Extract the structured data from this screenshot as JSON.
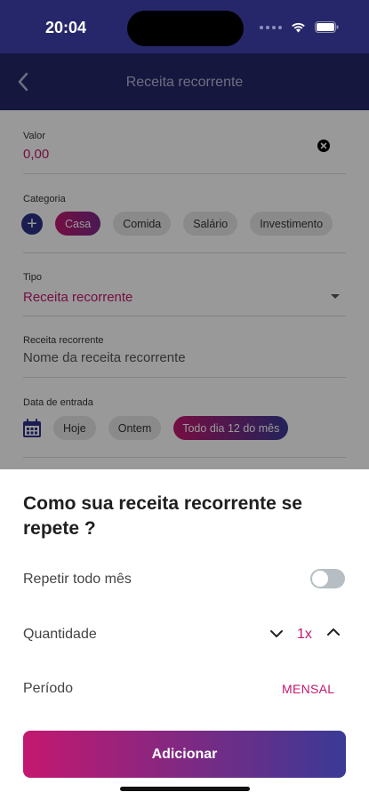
{
  "status_bar": {
    "time": "20:04"
  },
  "header": {
    "title": "Receita recorrente"
  },
  "form": {
    "valor": {
      "label": "Valor",
      "value": "0,00"
    },
    "categoria": {
      "label": "Categoria",
      "chips": [
        "Casa",
        "Comida",
        "Salário",
        "Investimento"
      ],
      "selected": "Casa"
    },
    "tipo": {
      "label": "Tipo",
      "value": "Receita recorrente"
    },
    "nome": {
      "label": "Receita recorrente",
      "placeholder": "Nome da receita recorrente"
    },
    "data": {
      "label": "Data de entrada",
      "chips": [
        "Hoje",
        "Ontem",
        "Todo dia 12 do mês"
      ],
      "selected": "Todo dia 12 do mês"
    }
  },
  "sheet": {
    "title": "Como sua receita recorrente se repete ?",
    "repeat_label": "Repetir todo mês",
    "repeat_on": false,
    "quantity_label": "Quantidade",
    "quantity_value": "1x",
    "period_label": "Período",
    "period_value": "MENSAL",
    "add_button": "Adicionar"
  },
  "colors": {
    "primary": "#26276a",
    "accent": "#c4186f",
    "gradient_end": "#3a3a96"
  }
}
